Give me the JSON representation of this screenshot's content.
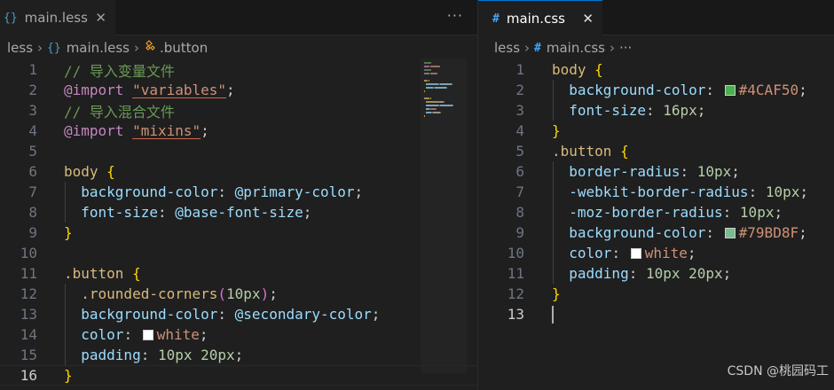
{
  "left_editor": {
    "tab": {
      "icon": "{}",
      "label": "main.less",
      "close": "✕"
    },
    "more_actions": "···",
    "breadcrumb": {
      "folder": "less",
      "file_icon": "{}",
      "file": "main.less",
      "symbol_icon": "class-icon",
      "symbol": ".button"
    },
    "lines": [
      {
        "num": "1",
        "tokens": [
          [
            "t-comment",
            "// 导入变量文件"
          ]
        ]
      },
      {
        "num": "2",
        "tokens": [
          [
            "t-keyword",
            "@import"
          ],
          [
            "t-plain",
            " "
          ],
          [
            "t-string",
            "\"variables\""
          ],
          [
            "t-plain",
            ";"
          ]
        ]
      },
      {
        "num": "3",
        "tokens": [
          [
            "t-comment",
            "// 导入混合文件"
          ]
        ]
      },
      {
        "num": "4",
        "tokens": [
          [
            "t-keyword",
            "@import"
          ],
          [
            "t-plain",
            " "
          ],
          [
            "t-string",
            "\"mixins\""
          ],
          [
            "t-plain",
            ";"
          ]
        ]
      },
      {
        "num": "5",
        "tokens": []
      },
      {
        "num": "6",
        "tokens": [
          [
            "t-selector",
            "body"
          ],
          [
            "t-plain",
            " "
          ],
          [
            "t-brace",
            "{"
          ]
        ]
      },
      {
        "num": "7",
        "tokens": [
          [
            "t-plain",
            "  "
          ],
          [
            "t-prop",
            "background-color"
          ],
          [
            "t-plain",
            ": "
          ],
          [
            "t-var",
            "@primary-color"
          ],
          [
            "t-plain",
            ";"
          ]
        ]
      },
      {
        "num": "8",
        "tokens": [
          [
            "t-plain",
            "  "
          ],
          [
            "t-prop",
            "font-size"
          ],
          [
            "t-plain",
            ": "
          ],
          [
            "t-var",
            "@base-font-size"
          ],
          [
            "t-plain",
            ";"
          ]
        ]
      },
      {
        "num": "9",
        "tokens": [
          [
            "t-brace",
            "}"
          ]
        ]
      },
      {
        "num": "10",
        "tokens": []
      },
      {
        "num": "11",
        "tokens": [
          [
            "t-selector",
            ".button"
          ],
          [
            "t-plain",
            " "
          ],
          [
            "t-brace",
            "{"
          ]
        ]
      },
      {
        "num": "12",
        "tokens": [
          [
            "t-plain",
            "  "
          ],
          [
            "t-selector",
            ".rounded-corners"
          ],
          [
            "t-paren",
            "("
          ],
          [
            "t-num",
            "10px"
          ],
          [
            "t-paren",
            ")"
          ],
          [
            "t-plain",
            ";"
          ]
        ]
      },
      {
        "num": "13",
        "tokens": [
          [
            "t-plain",
            "  "
          ],
          [
            "t-prop",
            "background-color"
          ],
          [
            "t-plain",
            ": "
          ],
          [
            "t-var",
            "@secondary-color"
          ],
          [
            "t-plain",
            ";"
          ]
        ]
      },
      {
        "num": "14",
        "tokens": [
          [
            "t-plain",
            "  "
          ],
          [
            "t-prop",
            "color"
          ],
          [
            "t-plain",
            ": "
          ],
          [
            "swatch",
            "#ffffff"
          ],
          [
            "t-value",
            "white"
          ],
          [
            "t-plain",
            ";"
          ]
        ]
      },
      {
        "num": "15",
        "tokens": [
          [
            "t-plain",
            "  "
          ],
          [
            "t-prop",
            "padding"
          ],
          [
            "t-plain",
            ": "
          ],
          [
            "t-num",
            "10px 20px"
          ],
          [
            "t-plain",
            ";"
          ]
        ]
      },
      {
        "num": "16",
        "tokens": [
          [
            "t-brace",
            "}"
          ]
        ]
      }
    ],
    "active_line": "16"
  },
  "right_editor": {
    "tab": {
      "icon": "#",
      "label": "main.css",
      "close": "✕"
    },
    "breadcrumb": {
      "folder": "less",
      "file_icon": "#",
      "file": "main.css",
      "more": "···"
    },
    "lines": [
      {
        "num": "1",
        "tokens": [
          [
            "t-selector",
            "body"
          ],
          [
            "t-plain",
            " "
          ],
          [
            "t-brace",
            "{"
          ]
        ]
      },
      {
        "num": "2",
        "tokens": [
          [
            "t-plain",
            "  "
          ],
          [
            "t-prop",
            "background-color"
          ],
          [
            "t-plain",
            ": "
          ],
          [
            "swatch",
            "#4CAF50"
          ],
          [
            "t-value",
            "#4CAF50"
          ],
          [
            "t-plain",
            ";"
          ]
        ]
      },
      {
        "num": "3",
        "tokens": [
          [
            "t-plain",
            "  "
          ],
          [
            "t-prop",
            "font-size"
          ],
          [
            "t-plain",
            ": "
          ],
          [
            "t-num",
            "16px"
          ],
          [
            "t-plain",
            ";"
          ]
        ]
      },
      {
        "num": "4",
        "tokens": [
          [
            "t-brace",
            "}"
          ]
        ]
      },
      {
        "num": "5",
        "tokens": [
          [
            "t-selector",
            ".button"
          ],
          [
            "t-plain",
            " "
          ],
          [
            "t-brace",
            "{"
          ]
        ]
      },
      {
        "num": "6",
        "tokens": [
          [
            "t-plain",
            "  "
          ],
          [
            "t-prop",
            "border-radius"
          ],
          [
            "t-plain",
            ": "
          ],
          [
            "t-num",
            "10px"
          ],
          [
            "t-plain",
            ";"
          ]
        ]
      },
      {
        "num": "7",
        "tokens": [
          [
            "t-plain",
            "  "
          ],
          [
            "t-prop",
            "-webkit-border-radius"
          ],
          [
            "t-plain",
            ": "
          ],
          [
            "t-num",
            "10px"
          ],
          [
            "t-plain",
            ";"
          ]
        ]
      },
      {
        "num": "8",
        "tokens": [
          [
            "t-plain",
            "  "
          ],
          [
            "t-prop",
            "-moz-border-radius"
          ],
          [
            "t-plain",
            ": "
          ],
          [
            "t-num",
            "10px"
          ],
          [
            "t-plain",
            ";"
          ]
        ]
      },
      {
        "num": "9",
        "tokens": [
          [
            "t-plain",
            "  "
          ],
          [
            "t-prop",
            "background-color"
          ],
          [
            "t-plain",
            ": "
          ],
          [
            "swatch",
            "#79BD8F"
          ],
          [
            "t-value",
            "#79BD8F"
          ],
          [
            "t-plain",
            ";"
          ]
        ]
      },
      {
        "num": "10",
        "tokens": [
          [
            "t-plain",
            "  "
          ],
          [
            "t-prop",
            "color"
          ],
          [
            "t-plain",
            ": "
          ],
          [
            "swatch",
            "#ffffff"
          ],
          [
            "t-value",
            "white"
          ],
          [
            "t-plain",
            ";"
          ]
        ]
      },
      {
        "num": "11",
        "tokens": [
          [
            "t-plain",
            "  "
          ],
          [
            "t-prop",
            "padding"
          ],
          [
            "t-plain",
            ": "
          ],
          [
            "t-num",
            "10px 20px"
          ],
          [
            "t-plain",
            ";"
          ]
        ]
      },
      {
        "num": "12",
        "tokens": [
          [
            "t-brace",
            "}"
          ]
        ]
      },
      {
        "num": "13",
        "tokens": []
      }
    ],
    "active_line": "13"
  },
  "watermark": "CSDN @桃园码工"
}
